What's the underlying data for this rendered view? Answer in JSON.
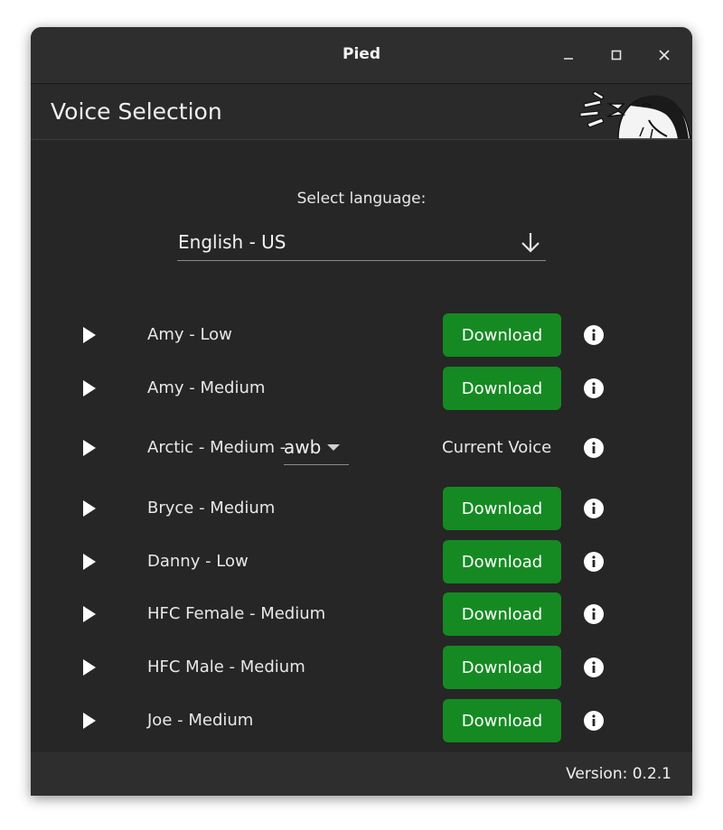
{
  "window": {
    "title": "Pied",
    "controls": {
      "minimize_icon": "minimize-icon",
      "maximize_icon": "maximize-icon",
      "close_icon": "close-icon"
    }
  },
  "header": {
    "title": "Voice Selection",
    "logo_icon": "penguin-mascot-icon"
  },
  "language": {
    "label": "Select language:",
    "selected": "English - US",
    "dropdown_icon": "arrow-down-icon"
  },
  "voices": [
    {
      "name": "Amy - Low",
      "action": "Download"
    },
    {
      "name": "Amy - Medium",
      "action": "Download"
    },
    {
      "name": "Arctic - Medium -",
      "speaker": "awb",
      "status": "Current Voice"
    },
    {
      "name": "Bryce - Medium",
      "action": "Download"
    },
    {
      "name": "Danny - Low",
      "action": "Download"
    },
    {
      "name": "HFC Female - Medium",
      "action": "Download"
    },
    {
      "name": "HFC Male - Medium",
      "action": "Download"
    },
    {
      "name": "Joe - Medium",
      "action": "Download"
    }
  ],
  "footer": {
    "version": "Version: 0.2.1"
  },
  "colors": {
    "background": "#262626",
    "titlebar": "#2e2e2e",
    "download_button": "#158a22",
    "text": "#e8e8e8"
  }
}
